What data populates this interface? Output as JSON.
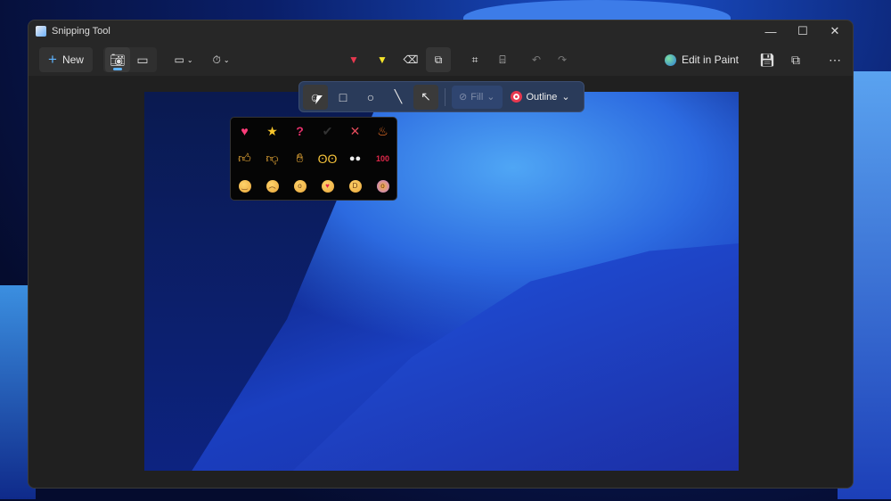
{
  "window": {
    "title": "Snipping Tool",
    "controls": [
      "minimize",
      "maximize",
      "close"
    ]
  },
  "toolbar": {
    "new_label": "New",
    "modes": [
      "screenshot-mode",
      "video-mode"
    ],
    "snip_shape": "rectangle-snip",
    "delay": "no-delay",
    "tools": [
      "ballpoint-pen",
      "highlighter",
      "eraser",
      "shapes",
      "crop",
      "text-actions",
      "undo",
      "redo"
    ],
    "edit_in_paint": "Edit in Paint",
    "right_actions": [
      "save",
      "copy",
      "more"
    ]
  },
  "shapes_bar": {
    "tools": [
      "emoji",
      "rectangle",
      "circle",
      "line",
      "arrow"
    ],
    "fill_label": "Fill",
    "outline_label": "Outline",
    "outline_color": "#e8384f"
  },
  "emoji_picker": {
    "items": [
      "heart",
      "star",
      "question",
      "check",
      "cross",
      "fire",
      "thumbs-up",
      "thumbs-down",
      "clap",
      "raised-hands",
      "eyes",
      "hundred",
      "smile",
      "frown",
      "surprised",
      "heart-eyes",
      "laugh",
      "crying"
    ]
  }
}
